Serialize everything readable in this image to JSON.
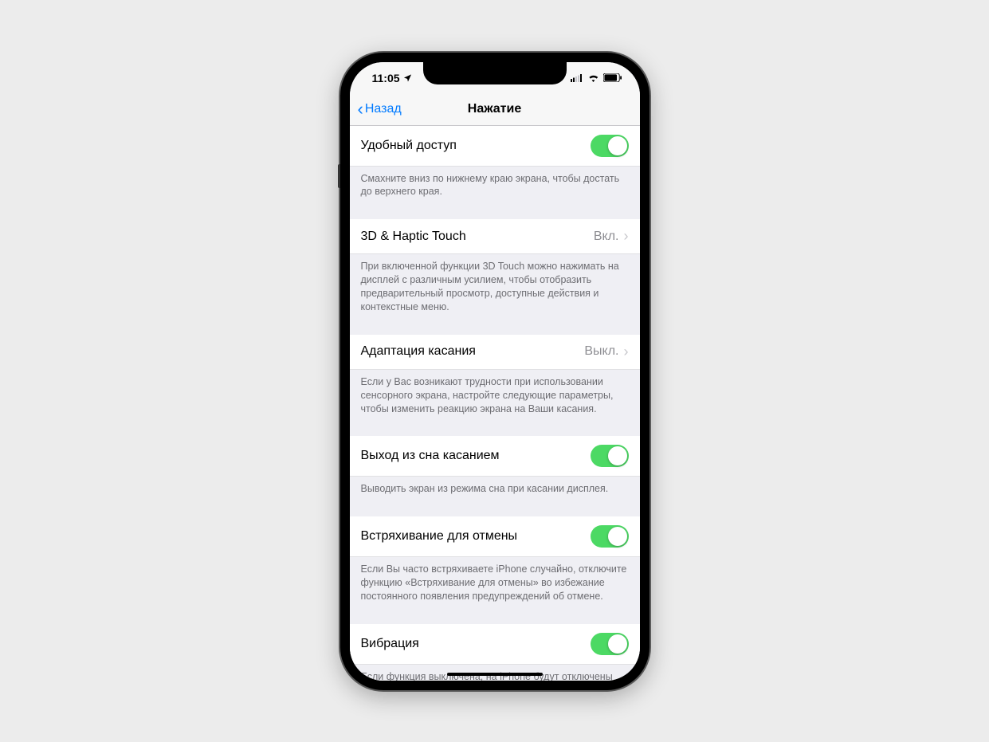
{
  "status": {
    "time": "11:05",
    "location_icon": "✈︎"
  },
  "nav": {
    "back": "Назад",
    "title": "Нажатие"
  },
  "sections": {
    "reachability": {
      "label": "Удобный доступ",
      "footer": "Смахните вниз по нижнему краю экрана, чтобы достать до верхнего края."
    },
    "haptic": {
      "label": "3D & Haptic Touch",
      "value": "Вкл.",
      "footer": "При включенной функции 3D Touch можно нажимать на дисплей с различным усилием, чтобы отобразить предварительный просмотр, доступные действия и контекстные меню."
    },
    "accommodation": {
      "label": "Адаптация касания",
      "value": "Выкл.",
      "footer": "Если у Вас возникают трудности при использовании сенсорного экрана, настройте следующие параметры, чтобы изменить реакцию экрана на Ваши касания."
    },
    "tapwake": {
      "label": "Выход из сна касанием",
      "footer": "Выводить экран из режима сна при касании дисплея."
    },
    "shake": {
      "label": "Встряхивание для отмены",
      "footer": "Если Вы часто встряхиваете iPhone случайно, отключите функцию «Встряхивание для отмены» во избежание постоянного появления предупреждений об отмене."
    },
    "vibration": {
      "label": "Вибрация",
      "footer": "Если функция выключена, на iPhone будут отключены все типы вибраций, в том числе вибрация уведомлений о землетрясениях, цунами и других экстренных ситуациях."
    }
  }
}
